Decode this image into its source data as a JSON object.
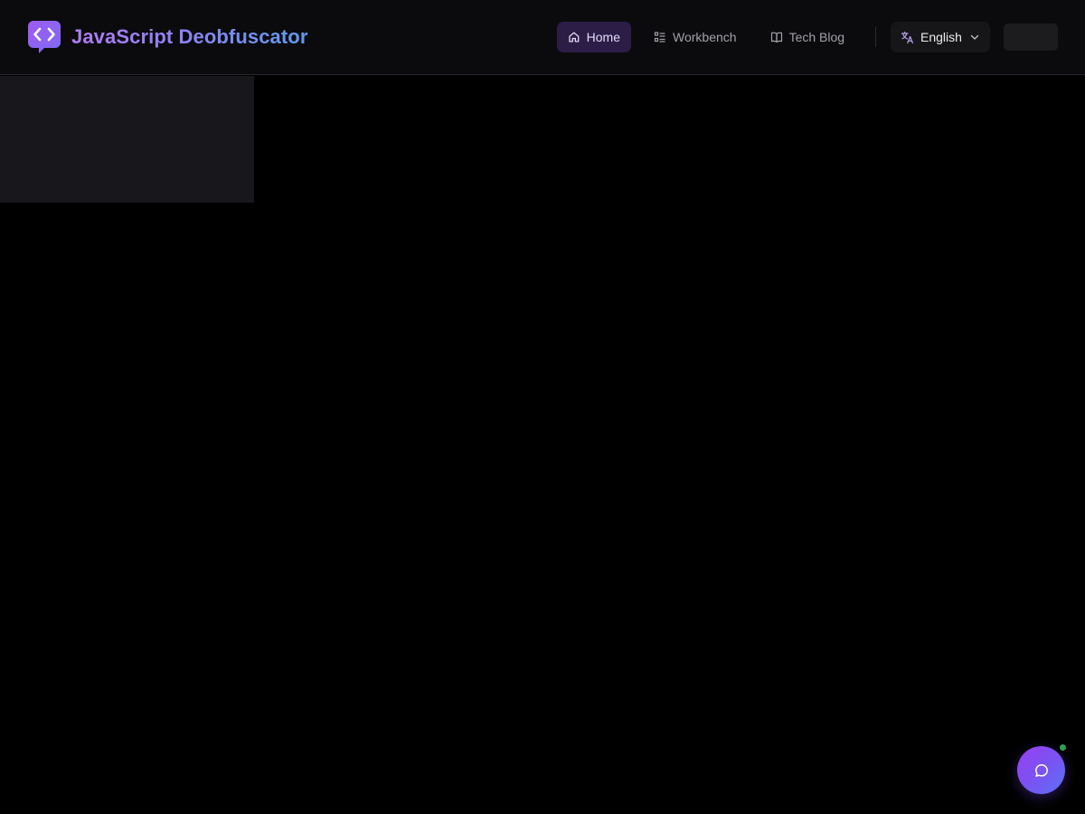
{
  "brand": {
    "title": "JavaScript Deobfuscator",
    "logo_icon": "code-chat-bubble-icon"
  },
  "nav": {
    "items": [
      {
        "label": "Home",
        "icon": "home-icon",
        "active": true
      },
      {
        "label": "Workbench",
        "icon": "list-checks-icon",
        "active": false
      },
      {
        "label": "Tech Blog",
        "icon": "open-book-icon",
        "active": false
      }
    ]
  },
  "language": {
    "selected": "English",
    "icon": "translate-icon",
    "chevron": "chevron-down-icon"
  },
  "chat": {
    "icon": "chat-bubble-icon",
    "status": "online"
  },
  "colors": {
    "background": "#000000",
    "header_bg": "#0b0b0d",
    "accent_purple": "#8b5cf6",
    "nav_active_bg": "#2b1d46",
    "brand_gradient_start": "#b07cf2",
    "brand_gradient_end": "#5d9cf0",
    "online_green": "#2f9e57"
  }
}
